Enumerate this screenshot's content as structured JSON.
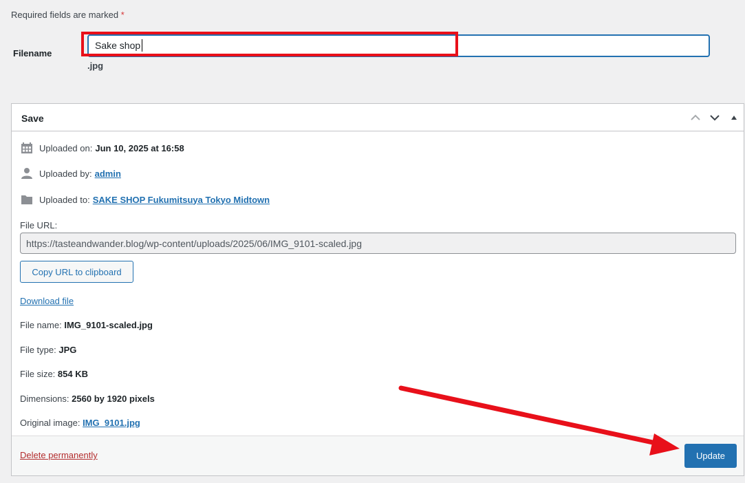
{
  "form": {
    "required_note": "Required fields are marked",
    "required_star": "*",
    "filename_label": "Filename",
    "filename_value": "Sake shop",
    "extension": ".jpg"
  },
  "panel": {
    "title": "Save",
    "uploaded_on_label": "Uploaded on:",
    "uploaded_on_value": "Jun 10, 2025 at 16:58",
    "uploaded_by_label": "Uploaded by:",
    "uploaded_by_value": "admin",
    "uploaded_to_label": "Uploaded to:",
    "uploaded_to_value": "SAKE SHOP Fukumitsuya Tokyo Midtown",
    "file_url_label": "File URL:",
    "file_url_value": "https://tasteandwander.blog/wp-content/uploads/2025/06/IMG_9101-scaled.jpg",
    "copy_button": "Copy URL to clipboard",
    "download_link": "Download file",
    "file_name_label": "File name:",
    "file_name_value": "IMG_9101-scaled.jpg",
    "file_type_label": "File type:",
    "file_type_value": "JPG",
    "file_size_label": "File size:",
    "file_size_value": "854 KB",
    "dimensions_label": "Dimensions:",
    "dimensions_value": "2560 by 1920 pixels",
    "original_label": "Original image:",
    "original_value": "IMG_9101.jpg",
    "delete_link": "Delete permanently",
    "update_button": "Update"
  },
  "icons": {
    "calendar": "calendar-icon",
    "user": "user-icon",
    "folder": "folder-icon",
    "move_up": "chevron-up-icon",
    "move_down": "chevron-down-icon",
    "toggle": "triangle-up-icon"
  },
  "colors": {
    "accent": "#2271b1",
    "danger": "#b32d2e",
    "annotation": "#e8101a"
  }
}
